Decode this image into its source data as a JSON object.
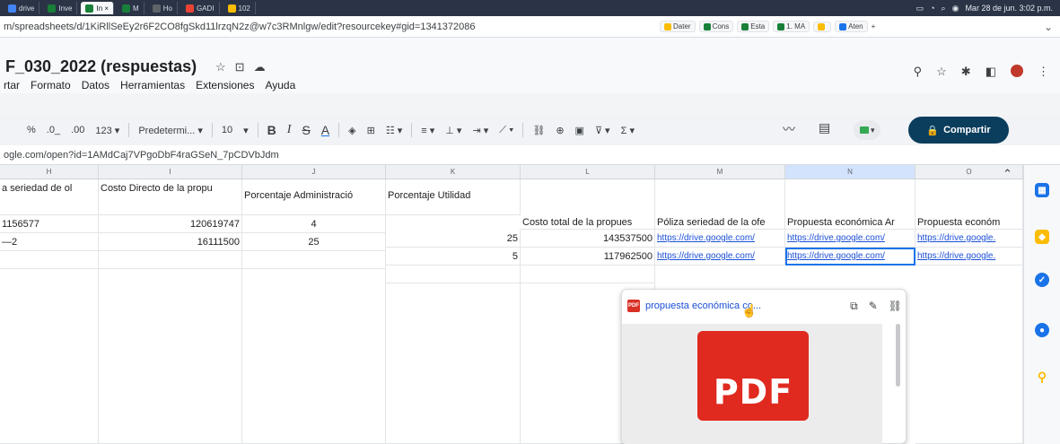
{
  "browser": {
    "tabs": [
      {
        "label": "drive",
        "color": "#4285f4",
        "active": false
      },
      {
        "label": "Inve",
        "color": "#188038",
        "active": false
      },
      {
        "label": "In ×",
        "color": "#188038",
        "active": true
      },
      {
        "label": "M",
        "color": "#188038",
        "active": false
      },
      {
        "label": "Ho",
        "color": "#5f6368",
        "active": false
      },
      {
        "label": "GADI",
        "color": "#ea4335",
        "active": false
      },
      {
        "label": "102",
        "color": "#fbbc04",
        "active": false
      }
    ],
    "tray_date": "Mar 28 de jun. 3:02 p.m.",
    "url": "m/spreadsheets/d/1KiRllSeEy2r6F2CO8fgSkd11lrzqN2z@w7c3RMnlgw/edit?resourcekey#gid=1341372086",
    "bookmarks": [
      {
        "label": "Dater",
        "color": "#fbbc04"
      },
      {
        "label": "Cons",
        "color": "#188038"
      },
      {
        "label": "Esta",
        "color": "#188038"
      },
      {
        "label": "1. MA",
        "color": "#188038"
      },
      {
        "label": "",
        "color": "#fbbc04"
      },
      {
        "label": "Aten",
        "color": "#1a73e8"
      }
    ]
  },
  "doc": {
    "title": "F_030_2022 (respuestas)",
    "menu": [
      "rtar",
      "Formato",
      "Datos",
      "Herramientas",
      "Extensiones",
      "Ayuda"
    ]
  },
  "toolbar": {
    "percent": "%",
    "dec_less": ".0_",
    "dec_more": ".00",
    "format_123": "123 ▾",
    "font": "Predetermi... ▾",
    "font_size": "10",
    "bold": "B",
    "italic": "I",
    "strike": "S",
    "text_color": "A",
    "share_label": "Compartir"
  },
  "formula_bar": "ogle.com/open?id=1AMdCaj7VPgoDbF4raGSeN_7pCDVbJdm",
  "grid": {
    "columns": [
      {
        "letter": "H",
        "width": 110,
        "selected": false
      },
      {
        "letter": "I",
        "width": 160,
        "selected": false
      },
      {
        "letter": "J",
        "width": 160,
        "selected": false
      },
      {
        "letter": "K",
        "width": 150,
        "selected": false
      },
      {
        "letter": "L",
        "width": 150,
        "selected": false
      },
      {
        "letter": "M",
        "width": 145,
        "selected": false
      },
      {
        "letter": "N",
        "width": 145,
        "selected": true
      },
      {
        "letter": "O",
        "width": 110,
        "selected": false
      }
    ],
    "header_row": [
      "a seriedad de ol",
      "Costo Directo de la propu",
      "Porcentaje Administració",
      "Porcentaje Utilidad",
      "Costo total de la propues",
      "Póliza seriedad de la ofe",
      "Propuesta económica Ar",
      "Propuesta económ"
    ],
    "rows": [
      [
        "1156577",
        "120619747",
        "4",
        "25",
        "143537500",
        "https://drive.google.com/",
        "https://drive.google.com/",
        "https://drive.google."
      ],
      [
        "—2",
        "16111500",
        "25",
        "5",
        "117962500",
        "https://drive.google.com/",
        "https://drive.google.com/",
        "https://drive.google."
      ]
    ]
  },
  "popup": {
    "file_name": "propuesta económica co...",
    "preview_label": "PDF",
    "icon_label": "PDF"
  }
}
